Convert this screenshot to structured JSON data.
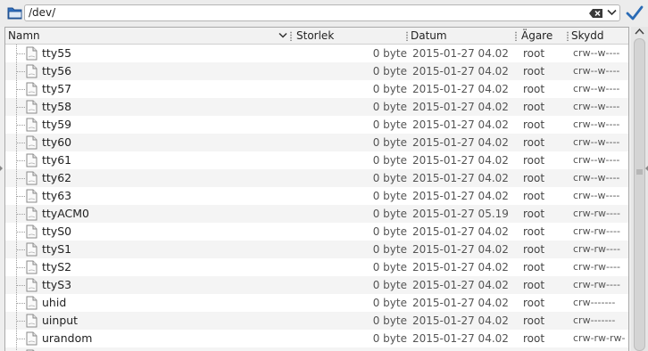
{
  "pathbar": {
    "path": "/dev/",
    "icons": {
      "folder": "folder-icon",
      "clear": "clear-text-icon",
      "dropdown": "chevron-down-icon",
      "go": "checkmark-icon"
    }
  },
  "columns": {
    "name": "Namn",
    "size": "Storlek",
    "date": "Datum",
    "owner": "Ägare",
    "perms": "Skydd"
  },
  "rows": [
    {
      "name": "tty55",
      "size": "0 byte",
      "date": "2015-01-27 04.02",
      "owner": "root",
      "perms": "crw--w----"
    },
    {
      "name": "tty56",
      "size": "0 byte",
      "date": "2015-01-27 04.02",
      "owner": "root",
      "perms": "crw--w----"
    },
    {
      "name": "tty57",
      "size": "0 byte",
      "date": "2015-01-27 04.02",
      "owner": "root",
      "perms": "crw--w----"
    },
    {
      "name": "tty58",
      "size": "0 byte",
      "date": "2015-01-27 04.02",
      "owner": "root",
      "perms": "crw--w----"
    },
    {
      "name": "tty59",
      "size": "0 byte",
      "date": "2015-01-27 04.02",
      "owner": "root",
      "perms": "crw--w----"
    },
    {
      "name": "tty60",
      "size": "0 byte",
      "date": "2015-01-27 04.02",
      "owner": "root",
      "perms": "crw--w----"
    },
    {
      "name": "tty61",
      "size": "0 byte",
      "date": "2015-01-27 04.02",
      "owner": "root",
      "perms": "crw--w----"
    },
    {
      "name": "tty62",
      "size": "0 byte",
      "date": "2015-01-27 04.02",
      "owner": "root",
      "perms": "crw--w----"
    },
    {
      "name": "tty63",
      "size": "0 byte",
      "date": "2015-01-27 04.02",
      "owner": "root",
      "perms": "crw--w----"
    },
    {
      "name": "ttyACM0",
      "size": "0 byte",
      "date": "2015-01-27 05.19",
      "owner": "root",
      "perms": "crw-rw----"
    },
    {
      "name": "ttyS0",
      "size": "0 byte",
      "date": "2015-01-27 04.02",
      "owner": "root",
      "perms": "crw-rw----"
    },
    {
      "name": "ttyS1",
      "size": "0 byte",
      "date": "2015-01-27 04.02",
      "owner": "root",
      "perms": "crw-rw----"
    },
    {
      "name": "ttyS2",
      "size": "0 byte",
      "date": "2015-01-27 04.02",
      "owner": "root",
      "perms": "crw-rw----"
    },
    {
      "name": "ttyS3",
      "size": "0 byte",
      "date": "2015-01-27 04.02",
      "owner": "root",
      "perms": "crw-rw----"
    },
    {
      "name": "uhid",
      "size": "0 byte",
      "date": "2015-01-27 04.02",
      "owner": "root",
      "perms": "crw-------"
    },
    {
      "name": "uinput",
      "size": "0 byte",
      "date": "2015-01-27 04.02",
      "owner": "root",
      "perms": "crw-------"
    },
    {
      "name": "urandom",
      "size": "0 byte",
      "date": "2015-01-27 04.02",
      "owner": "root",
      "perms": "crw-rw-rw-"
    },
    {
      "name": "",
      "size": "",
      "date": "",
      "owner": "",
      "perms": ""
    }
  ],
  "colors": {
    "accent": "#2a6bb5",
    "row_alt": "#f4f4f4"
  }
}
